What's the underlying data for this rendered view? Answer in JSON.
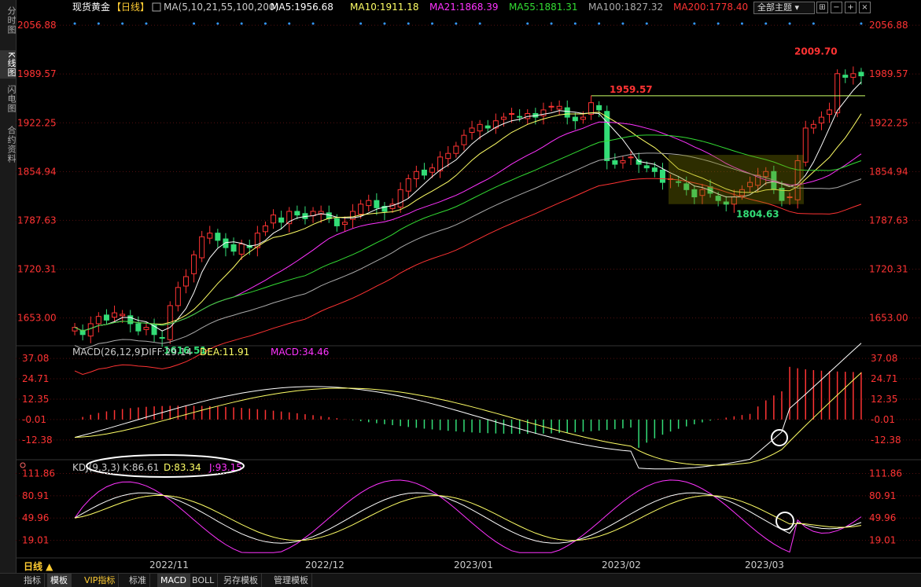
{
  "sidebar": [
    {
      "label": "分时图",
      "active": false
    },
    {
      "label": "K线图",
      "active": true
    },
    {
      "label": "闪电图",
      "active": false
    },
    {
      "label": "合约资料",
      "active": false
    }
  ],
  "header": {
    "symbol": "现货黄金",
    "period_tag": "【日线】",
    "ma_params": "MA(5,10,21,55,100,200)",
    "ma": [
      {
        "label": "MA5:1956.68",
        "color": "#ffffff"
      },
      {
        "label": "MA10:1911.18",
        "color": "#ffff66"
      },
      {
        "label": "MA21:1868.39",
        "color": "#ff33ff"
      },
      {
        "label": "MA55:1881.31",
        "color": "#33dd33"
      },
      {
        "label": "MA100:1827.32",
        "color": "#aaaaaa"
      },
      {
        "label": "MA200:1778.40",
        "color": "#ff3333"
      }
    ],
    "theme_button": "全部主题",
    "tool_icons": [
      "grid-icon",
      "minus-icon",
      "plus-icon",
      "close-icon"
    ]
  },
  "colors": {
    "up": "#ff3333",
    "down": "#33dd77",
    "axis": "#ff3333",
    "grid": "#551111"
  },
  "chart_data": [
    {
      "type": "candlestick",
      "title": "现货黄金【日线】",
      "y_ticks": [
        "2056.88",
        "1989.57",
        "1922.25",
        "1854.94",
        "1787.63",
        "1720.31",
        "1653.00"
      ],
      "ylim": [
        1620,
        2070
      ],
      "x_labels": [
        "2022/11",
        "2022/12",
        "2023/01",
        "2023/02",
        "2023/03"
      ],
      "annotations": [
        {
          "text": "2009.70",
          "value": 2009.7,
          "kind": "high",
          "color": "#ff3333"
        },
        {
          "text": "1959.57",
          "value": 1959.57,
          "kind": "resistance-line",
          "color": "#ff3333"
        },
        {
          "text": "1804.63",
          "value": 1804.63,
          "kind": "low",
          "color": "#33dd77"
        },
        {
          "text": "1616.51",
          "value": 1616.51,
          "kind": "low",
          "color": "#33dd77"
        }
      ],
      "ma_series": [
        {
          "name": "MA5",
          "color": "#ffffff"
        },
        {
          "name": "MA10",
          "color": "#ffff66"
        },
        {
          "name": "MA21",
          "color": "#ff33ff"
        },
        {
          "name": "MA55",
          "color": "#33dd33"
        },
        {
          "name": "MA100",
          "color": "#aaaaaa"
        },
        {
          "name": "MA200",
          "color": "#ff3333"
        }
      ],
      "closes": [
        1640,
        1630,
        1645,
        1655,
        1650,
        1660,
        1658,
        1645,
        1635,
        1640,
        1630,
        1625,
        1670,
        1695,
        1710,
        1740,
        1765,
        1770,
        1760,
        1750,
        1745,
        1755,
        1750,
        1770,
        1780,
        1795,
        1785,
        1800,
        1795,
        1790,
        1800,
        1800,
        1790,
        1780,
        1785,
        1800,
        1810,
        1815,
        1805,
        1800,
        1810,
        1830,
        1845,
        1855,
        1850,
        1860,
        1875,
        1880,
        1890,
        1905,
        1915,
        1920,
        1915,
        1925,
        1930,
        1935,
        1930,
        1935,
        1930,
        1940,
        1945,
        1945,
        1930,
        1925,
        1930,
        1950,
        1940,
        1870,
        1865,
        1870,
        1875,
        1865,
        1860,
        1855,
        1840,
        1845,
        1840,
        1830,
        1820,
        1830,
        1825,
        1815,
        1810,
        1820,
        1830,
        1840,
        1850,
        1855,
        1830,
        1815,
        1820,
        1870,
        1915,
        1920,
        1930,
        1940,
        1990,
        1985,
        1990,
        1987
      ]
    },
    {
      "type": "line",
      "title": "MACD(26,12,9)",
      "legend": [
        {
          "label": "MACD(26,12,9)",
          "color": "#cccccc"
        },
        {
          "label": "DIFF:29.14",
          "color": "#cccccc"
        },
        {
          "label": "DEA:11.91",
          "color": "#ffff66"
        },
        {
          "label": "MACD:34.46",
          "color": "#ff33ff"
        }
      ],
      "y_ticks": [
        "37.08",
        "24.71",
        "12.35",
        "-0.01",
        "-12.38"
      ],
      "ylim": [
        -22,
        40
      ]
    },
    {
      "type": "line",
      "title": "KDJ(9,3,3)",
      "legend": [
        {
          "label": "KDJ(9,3,3)",
          "color": "#cccccc"
        },
        {
          "label": "K:86.61",
          "color": "#cccccc"
        },
        {
          "label": "D:83.34",
          "color": "#ffff66"
        },
        {
          "label": "J:93.15",
          "color": "#ff33ff"
        }
      ],
      "y_ticks": [
        "111.86",
        "80.91",
        "49.96",
        "19.01"
      ],
      "ylim": [
        0,
        120
      ]
    }
  ],
  "period_button": "日线 ▲",
  "bottom_tabs": [
    {
      "label": "指标",
      "active": false
    },
    {
      "label": "模板",
      "active": true
    },
    {
      "label": "VIP指标",
      "active": false,
      "vip": true
    },
    {
      "label": "标准",
      "active": false
    },
    {
      "label": "MACD",
      "active": true
    },
    {
      "label": "BOLL",
      "active": false
    },
    {
      "label": "另存模板",
      "active": false
    },
    {
      "label": "管理模板",
      "active": false
    }
  ]
}
